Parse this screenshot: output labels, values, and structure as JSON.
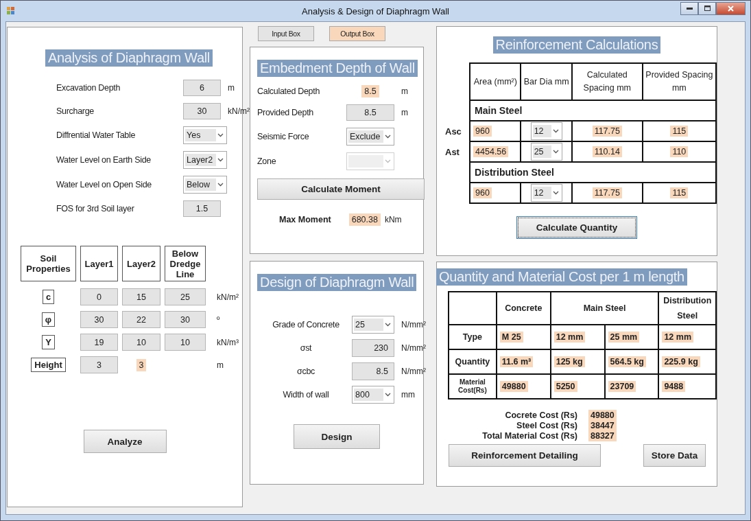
{
  "window": {
    "title": "Analysis & Design of Diaphragm Wall"
  },
  "analysis": {
    "title": "Analysis of Diaphragm Wall",
    "fields": [
      {
        "label": "Excavation Depth",
        "kind": "input",
        "value": "6",
        "unit": "m"
      },
      {
        "label": "Surcharge",
        "kind": "input",
        "value": "30",
        "unit": "kN/m²"
      },
      {
        "label": "Diffrential Water Table",
        "kind": "select",
        "value": "Yes"
      },
      {
        "label": "Water Level on Earth Side",
        "kind": "select",
        "value": "Layer2"
      },
      {
        "label": "Water Level on Open Side",
        "kind": "select",
        "value": "Below"
      },
      {
        "label": "FOS for 3rd Soil layer",
        "kind": "input",
        "value": "1.5"
      }
    ],
    "soil_table": {
      "columns": [
        "Soil Properties",
        "Layer1",
        "Layer2",
        "Below Dredge Line"
      ],
      "rows": [
        {
          "cells": [
            {
              "kind": "symbol",
              "value": "c"
            },
            {
              "kind": "input",
              "value": "0"
            },
            {
              "kind": "input",
              "value": "15"
            },
            {
              "kind": "input",
              "value": "25"
            },
            {
              "kind": "unit",
              "value": "kN/m²"
            }
          ]
        },
        {
          "cells": [
            {
              "kind": "symbol",
              "value": "φ"
            },
            {
              "kind": "input",
              "value": "30"
            },
            {
              "kind": "input",
              "value": "22"
            },
            {
              "kind": "input",
              "value": "30"
            },
            {
              "kind": "unit",
              "value": "º"
            }
          ]
        },
        {
          "cells": [
            {
              "kind": "symbol",
              "value": "Y"
            },
            {
              "kind": "input",
              "value": "19"
            },
            {
              "kind": "input",
              "value": "10"
            },
            {
              "kind": "input",
              "value": "10"
            },
            {
              "kind": "unit",
              "value": "kN/m³"
            }
          ]
        },
        {
          "cells": [
            {
              "kind": "symbol",
              "value": "Height"
            },
            {
              "kind": "input",
              "value": "3"
            },
            {
              "kind": "output",
              "value": "3"
            },
            "",
            {
              "kind": "unit",
              "value": "m"
            }
          ]
        }
      ]
    },
    "button": "Analyze"
  },
  "legend": [
    {
      "label": "Input Box",
      "kind": "input"
    },
    {
      "label": "Output Box",
      "kind": "output"
    }
  ],
  "embedment": {
    "title": "Embedment Depth of Wall",
    "fields": [
      {
        "label": "Calculated Depth",
        "kind": "output",
        "value": "8.5",
        "unit": "m",
        "disabled": false
      },
      {
        "label": "Provided Depth",
        "kind": "input",
        "value": "8.5",
        "unit": "m",
        "disabled": false
      },
      {
        "label": "Seismic Force",
        "kind": "select",
        "value": "Exclude",
        "disabled": false
      },
      {
        "label": "Zone",
        "kind": "select",
        "disabled": true
      }
    ],
    "button": "Calculate Moment",
    "result": {
      "label": "Max Moment",
      "value": "680.38",
      "unit": "kNm"
    }
  },
  "design": {
    "title": "Design of Diaphragm Wall",
    "fields": [
      {
        "label": "Grade of Concrete",
        "kind": "select",
        "value": "25",
        "unit": "N/mm²"
      },
      {
        "label": "σst",
        "kind": "input",
        "value": "230",
        "unit": "N/mm²"
      },
      {
        "label": "σcbc",
        "kind": "input",
        "value": "8.5",
        "unit": "N/mm²"
      },
      {
        "label": "Width of wall",
        "kind": "select",
        "value": "800",
        "unit": "mm"
      }
    ],
    "button": "Design"
  },
  "reinforcement": {
    "title": "Reinforcement Calculations",
    "columns": [
      "Area (mm²)",
      "Bar Dia mm",
      "Calculated Spacing mm",
      "Provided Spacing mm"
    ],
    "sections": [
      {
        "title": "Main Steel",
        "rows": [
          {
            "label": "Asc",
            "area": "960",
            "bar_dia": "12",
            "calculated": "117.75",
            "provided": "115"
          },
          {
            "label": "Ast",
            "area": "4454.56",
            "bar_dia": "25",
            "calculated": "110.14",
            "provided": "110"
          }
        ]
      },
      {
        "title": "Distribution Steel",
        "rows": [
          {
            "area": "960",
            "bar_dia": "12",
            "calculated": "117.75",
            "provided": "115"
          }
        ]
      }
    ],
    "button": "Calculate Quantity"
  },
  "quantity": {
    "title": "Quantity and Material Cost  per 1 m length",
    "columns": [
      "Concrete",
      "Main Steel",
      "Distribution Steel"
    ],
    "rows": [
      {
        "label": "Type",
        "values": [
          "M 25",
          [
            "12 mm",
            "25 mm"
          ],
          "12 mm"
        ]
      },
      {
        "label": "Quantity",
        "values": [
          "11.6 m³",
          [
            "125 kg",
            "564.5 kg"
          ],
          "225.9 kg"
        ]
      },
      {
        "label": "Material Cost(Rs)",
        "values": [
          "49880",
          [
            "5250",
            "23709"
          ],
          "9488"
        ]
      }
    ]
  },
  "totals": [
    {
      "label": "Cocrete Cost (Rs)",
      "value": "49880"
    },
    {
      "label": "Steel Cost (Rs)",
      "value": "38447"
    },
    {
      "label": "Total Material Cost (Rs)",
      "value": "88327"
    }
  ],
  "buttons": [
    "Reinforcement Detailing",
    "Store Data"
  ]
}
